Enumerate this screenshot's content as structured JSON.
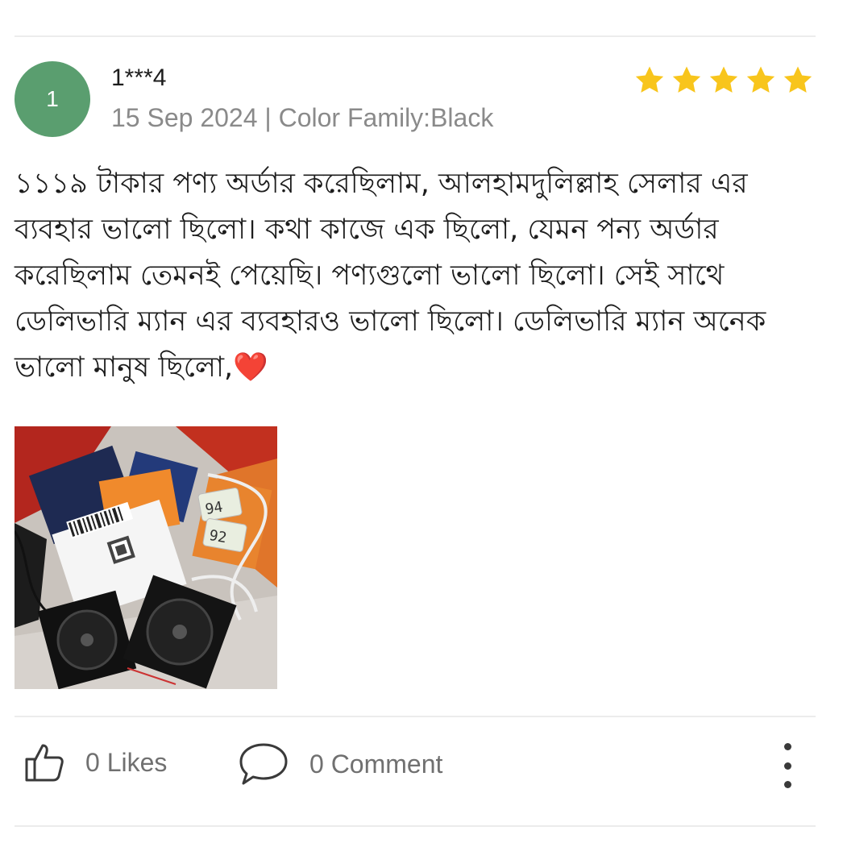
{
  "review": {
    "avatar_initial": "1",
    "username": "1***4",
    "meta": "15 Sep 2024 | Color Family:Black",
    "rating": 5,
    "star_color": "#f8c51c",
    "text": "১১১৯ টাকার পণ্য অর্ডার করেছিলাম, আলহামদুলিল্লাহ সেলার এর ব্যবহার ভালো ছিলো। কথা কাজে এক ছিলো, যেমন পন্য অর্ডার করেছিলাম তেমনই পেয়েছি। পণ্যগুলো ভালো ছিলো। সেই সাথে ডেলিভারি ম্যান এর ব্যবহারও ভালো ছিলো। ডেলিভারি ম্যান অনেক ভালো মানুষ ছিলো,❤️"
  },
  "photo": {
    "display_1": "94",
    "display_2": "92"
  },
  "actions": {
    "likes_label": "0 Likes",
    "comment_label": "0 Comment"
  }
}
